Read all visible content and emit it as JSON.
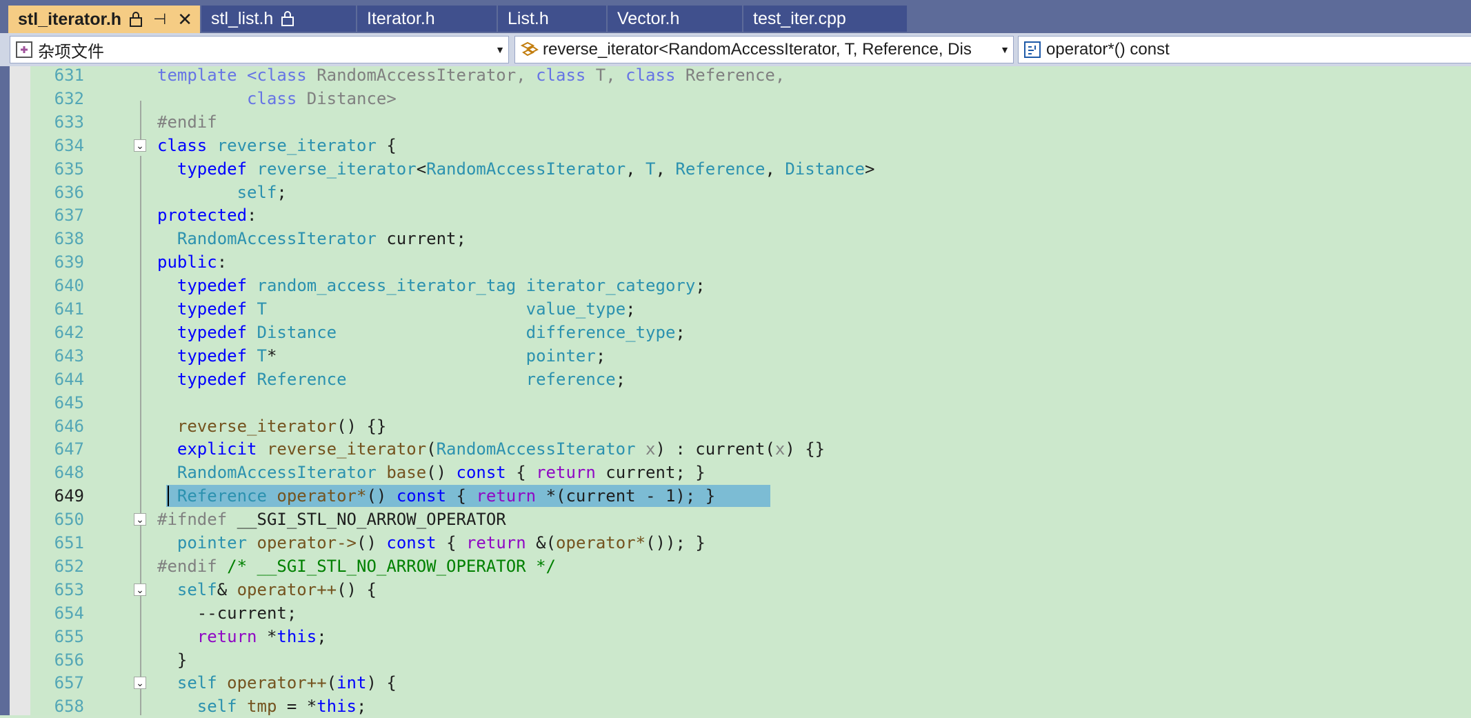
{
  "tabs": [
    {
      "label": "stl_iterator.h",
      "active": true,
      "locked": true,
      "pinned": true
    },
    {
      "label": "stl_list.h",
      "locked": true
    },
    {
      "label": "Iterator.h"
    },
    {
      "label": "List.h"
    },
    {
      "label": "Vector.h"
    },
    {
      "label": "test_iter.cpp"
    }
  ],
  "nav": {
    "project": "杂项文件",
    "scope": "reverse_iterator<RandomAccessIterator, T, Reference, Dis",
    "member": "operator*() const"
  },
  "editor": {
    "current_line": "649",
    "lines": [
      {
        "n": "631",
        "parts": [
          {
            "t": "template <",
            "c": "kw dim"
          },
          {
            "t": "class",
            "c": "kw dim"
          },
          {
            "t": " RandomAccessIterator, ",
            "c": "pp"
          },
          {
            "t": "class",
            "c": "kw dim"
          },
          {
            "t": " T, ",
            "c": "pp"
          },
          {
            "t": "class",
            "c": "kw dim"
          },
          {
            "t": " Reference,",
            "c": "pp"
          }
        ]
      },
      {
        "n": "632",
        "parts": [
          {
            "t": "         ",
            "c": ""
          },
          {
            "t": "class",
            "c": "kw dim"
          },
          {
            "t": " Distance>",
            "c": "pp"
          }
        ]
      },
      {
        "n": "633",
        "parts": [
          {
            "t": "#endif",
            "c": "pp"
          }
        ]
      },
      {
        "n": "634",
        "parts": [
          {
            "t": "class",
            "c": "kw"
          },
          {
            "t": " ",
            "c": ""
          },
          {
            "t": "reverse_iterator",
            "c": "ty"
          },
          {
            "t": " {",
            "c": ""
          }
        ]
      },
      {
        "n": "635",
        "parts": [
          {
            "t": "  ",
            "c": ""
          },
          {
            "t": "typedef",
            "c": "kw"
          },
          {
            "t": " ",
            "c": ""
          },
          {
            "t": "reverse_iterator",
            "c": "ty"
          },
          {
            "t": "<",
            "c": ""
          },
          {
            "t": "RandomAccessIterator",
            "c": "tp"
          },
          {
            "t": ", ",
            "c": ""
          },
          {
            "t": "T",
            "c": "tp"
          },
          {
            "t": ", ",
            "c": ""
          },
          {
            "t": "Reference",
            "c": "tp"
          },
          {
            "t": ", ",
            "c": ""
          },
          {
            "t": "Distance",
            "c": "tp"
          },
          {
            "t": ">",
            "c": ""
          }
        ]
      },
      {
        "n": "636",
        "parts": [
          {
            "t": "        ",
            "c": ""
          },
          {
            "t": "self",
            "c": "ty"
          },
          {
            "t": ";",
            "c": ""
          }
        ]
      },
      {
        "n": "637",
        "parts": [
          {
            "t": "protected",
            "c": "kw"
          },
          {
            "t": ":",
            "c": ""
          }
        ]
      },
      {
        "n": "638",
        "parts": [
          {
            "t": "  ",
            "c": ""
          },
          {
            "t": "RandomAccessIterator",
            "c": "tp"
          },
          {
            "t": " current;",
            "c": ""
          }
        ]
      },
      {
        "n": "639",
        "parts": [
          {
            "t": "public",
            "c": "kw"
          },
          {
            "t": ":",
            "c": ""
          }
        ]
      },
      {
        "n": "640",
        "parts": [
          {
            "t": "  ",
            "c": ""
          },
          {
            "t": "typedef",
            "c": "kw"
          },
          {
            "t": " ",
            "c": ""
          },
          {
            "t": "random_access_iterator_tag",
            "c": "ty"
          },
          {
            "t": " ",
            "c": ""
          },
          {
            "t": "iterator_category",
            "c": "ty"
          },
          {
            "t": ";",
            "c": ""
          }
        ]
      },
      {
        "n": "641",
        "parts": [
          {
            "t": "  ",
            "c": ""
          },
          {
            "t": "typedef",
            "c": "kw"
          },
          {
            "t": " ",
            "c": ""
          },
          {
            "t": "T",
            "c": "tp"
          },
          {
            "t": "                          ",
            "c": ""
          },
          {
            "t": "value_type",
            "c": "ty"
          },
          {
            "t": ";",
            "c": ""
          }
        ]
      },
      {
        "n": "642",
        "parts": [
          {
            "t": "  ",
            "c": ""
          },
          {
            "t": "typedef",
            "c": "kw"
          },
          {
            "t": " ",
            "c": ""
          },
          {
            "t": "Distance",
            "c": "tp"
          },
          {
            "t": "                   ",
            "c": ""
          },
          {
            "t": "difference_type",
            "c": "ty"
          },
          {
            "t": ";",
            "c": ""
          }
        ]
      },
      {
        "n": "643",
        "parts": [
          {
            "t": "  ",
            "c": ""
          },
          {
            "t": "typedef",
            "c": "kw"
          },
          {
            "t": " ",
            "c": ""
          },
          {
            "t": "T",
            "c": "tp"
          },
          {
            "t": "*                         ",
            "c": ""
          },
          {
            "t": "pointer",
            "c": "ty"
          },
          {
            "t": ";",
            "c": ""
          }
        ]
      },
      {
        "n": "644",
        "parts": [
          {
            "t": "  ",
            "c": ""
          },
          {
            "t": "typedef",
            "c": "kw"
          },
          {
            "t": " ",
            "c": ""
          },
          {
            "t": "Reference",
            "c": "tp"
          },
          {
            "t": "                  ",
            "c": ""
          },
          {
            "t": "reference",
            "c": "ty"
          },
          {
            "t": ";",
            "c": ""
          }
        ]
      },
      {
        "n": "645",
        "parts": []
      },
      {
        "n": "646",
        "parts": [
          {
            "t": "  ",
            "c": ""
          },
          {
            "t": "reverse_iterator",
            "c": "fn"
          },
          {
            "t": "() {}",
            "c": ""
          }
        ]
      },
      {
        "n": "647",
        "parts": [
          {
            "t": "  ",
            "c": ""
          },
          {
            "t": "explicit",
            "c": "kw"
          },
          {
            "t": " ",
            "c": ""
          },
          {
            "t": "reverse_iterator",
            "c": "fn"
          },
          {
            "t": "(",
            "c": ""
          },
          {
            "t": "RandomAccessIterator",
            "c": "tp"
          },
          {
            "t": " ",
            "c": ""
          },
          {
            "t": "x",
            "c": "pp"
          },
          {
            "t": ") : current(",
            "c": ""
          },
          {
            "t": "x",
            "c": "pp"
          },
          {
            "t": ") {}",
            "c": ""
          }
        ]
      },
      {
        "n": "648",
        "parts": [
          {
            "t": "  ",
            "c": ""
          },
          {
            "t": "RandomAccessIterator",
            "c": "tp"
          },
          {
            "t": " ",
            "c": ""
          },
          {
            "t": "base",
            "c": "fn"
          },
          {
            "t": "() ",
            "c": ""
          },
          {
            "t": "const",
            "c": "kw"
          },
          {
            "t": " { ",
            "c": ""
          },
          {
            "t": "return",
            "c": "ctl"
          },
          {
            "t": " current; }",
            "c": ""
          }
        ]
      },
      {
        "n": "649",
        "selected": true,
        "parts": [
          {
            "t": "  ",
            "c": ""
          },
          {
            "t": "Reference",
            "c": "tp"
          },
          {
            "t": " ",
            "c": ""
          },
          {
            "t": "operator*",
            "c": "fn"
          },
          {
            "t": "() ",
            "c": ""
          },
          {
            "t": "const",
            "c": "kw"
          },
          {
            "t": " { ",
            "c": ""
          },
          {
            "t": "return",
            "c": "ctl"
          },
          {
            "t": " *(current - 1); }",
            "c": ""
          }
        ]
      },
      {
        "n": "650",
        "parts": [
          {
            "t": "#ifndef",
            "c": "pp"
          },
          {
            "t": " __SGI_STL_NO_ARROW_OPERATOR",
            "c": ""
          }
        ]
      },
      {
        "n": "651",
        "parts": [
          {
            "t": "  ",
            "c": ""
          },
          {
            "t": "pointer",
            "c": "ty"
          },
          {
            "t": " ",
            "c": ""
          },
          {
            "t": "operator->",
            "c": "fn"
          },
          {
            "t": "() ",
            "c": ""
          },
          {
            "t": "const",
            "c": "kw"
          },
          {
            "t": " { ",
            "c": ""
          },
          {
            "t": "return",
            "c": "ctl"
          },
          {
            "t": " &(",
            "c": ""
          },
          {
            "t": "operator*",
            "c": "fn"
          },
          {
            "t": "()); }",
            "c": ""
          }
        ]
      },
      {
        "n": "652",
        "parts": [
          {
            "t": "#endif",
            "c": "pp"
          },
          {
            "t": " /* __SGI_STL_NO_ARROW_OPERATOR */",
            "c": "cm"
          }
        ]
      },
      {
        "n": "653",
        "parts": [
          {
            "t": "  ",
            "c": ""
          },
          {
            "t": "self",
            "c": "ty"
          },
          {
            "t": "& ",
            "c": ""
          },
          {
            "t": "operator++",
            "c": "fn"
          },
          {
            "t": "() {",
            "c": ""
          }
        ]
      },
      {
        "n": "654",
        "parts": [
          {
            "t": "    --current;",
            "c": ""
          }
        ]
      },
      {
        "n": "655",
        "parts": [
          {
            "t": "    ",
            "c": ""
          },
          {
            "t": "return",
            "c": "ctl"
          },
          {
            "t": " *",
            "c": ""
          },
          {
            "t": "this",
            "c": "kw"
          },
          {
            "t": ";",
            "c": ""
          }
        ]
      },
      {
        "n": "656",
        "parts": [
          {
            "t": "  }",
            "c": ""
          }
        ]
      },
      {
        "n": "657",
        "parts": [
          {
            "t": "  ",
            "c": ""
          },
          {
            "t": "self",
            "c": "ty"
          },
          {
            "t": " ",
            "c": ""
          },
          {
            "t": "operator++",
            "c": "fn"
          },
          {
            "t": "(",
            "c": ""
          },
          {
            "t": "int",
            "c": "kw"
          },
          {
            "t": ") {",
            "c": ""
          }
        ]
      },
      {
        "n": "658",
        "parts": [
          {
            "t": "    ",
            "c": ""
          },
          {
            "t": "self",
            "c": "ty"
          },
          {
            "t": " ",
            "c": ""
          },
          {
            "t": "tmp",
            "c": "fn"
          },
          {
            "t": " = *",
            "c": ""
          },
          {
            "t": "this",
            "c": "kw"
          },
          {
            "t": ";",
            "c": ""
          }
        ]
      }
    ]
  }
}
